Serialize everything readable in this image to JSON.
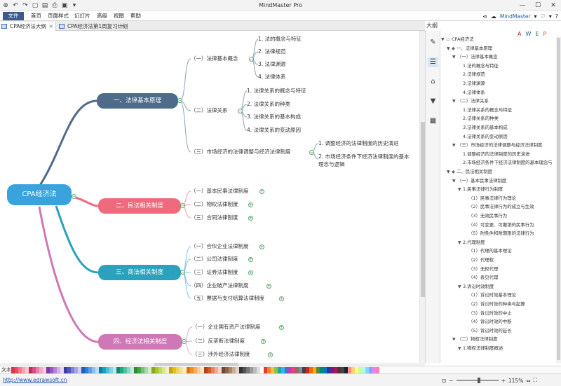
{
  "app": {
    "title": "MindMaster Pro",
    "account": "MindMaster",
    "window_controls": [
      "—",
      "☐",
      "✕"
    ]
  },
  "menubar": {
    "file": "文件",
    "items": [
      "首页",
      "页面样式",
      "幻灯片",
      "高级",
      "视图",
      "帮助"
    ]
  },
  "tabs": [
    {
      "label": "CPA经济法大纲",
      "active": true
    },
    {
      "label": "CPA经济法第1周复习计划",
      "active": false
    }
  ],
  "mindmap": {
    "central": "CPA经济法",
    "branches": [
      {
        "label": "一、法律基本原理",
        "color": "#4e6b89",
        "children": [
          {
            "label": "（一）法律基本概念",
            "children": [
              "1. 法的概念与特征",
              "2. 法律规范",
              "3. 法律渊源",
              "4. 法律体系"
            ]
          },
          {
            "label": "（二）法律关系",
            "children": [
              "1. 法律关系的概念与特征",
              "2. 法律关系的种类",
              "3. 法律关系的基本构成",
              "4. 法律关系的变动原因"
            ]
          },
          {
            "label": "（三）市场经济的法律调整与经济法律制度",
            "children": [
              "1. 调整经济的法律制度的历史演进",
              "2. 市场经济条件下经济法律制度的基本理念与逻辑"
            ]
          }
        ]
      },
      {
        "label": "二、民法相关制度",
        "color": "#ee6a7c",
        "children": [
          {
            "label": "（一）基本民事法律制度"
          },
          {
            "label": "（二）物权法律制度"
          },
          {
            "label": "（三）合同法律制度"
          }
        ]
      },
      {
        "label": "三、商法相关制度",
        "color": "#2aa2be",
        "children": [
          {
            "label": "（一）合伙企业法律制度"
          },
          {
            "label": "（二）公司法律制度"
          },
          {
            "label": "（三）证券法律制度"
          },
          {
            "label": "（四）企业破产法律制度"
          },
          {
            "label": "（五）票据与支付结算法律制度"
          }
        ]
      },
      {
        "label": "四、经济法相关制度",
        "color": "#cf77b7",
        "children": [
          {
            "label": "（一）企业国有资产法律制度"
          },
          {
            "label": "（二）反垄断法律制度"
          },
          {
            "label": "（三）涉外经济法律制度"
          }
        ]
      }
    ]
  },
  "outline": {
    "title": "大纲",
    "tools": [
      "A",
      "W",
      "E",
      "P"
    ],
    "rows": [
      {
        "level": 0,
        "text": "CPA经济法",
        "caret": "▼"
      },
      {
        "level": 1,
        "text": "一、法律基本原理",
        "caret": "▼"
      },
      {
        "level": 2,
        "text": "（一）法律基本概念",
        "caret": "▼"
      },
      {
        "level": 3,
        "text": "1.法的概念与特征"
      },
      {
        "level": 3,
        "text": "2.法律规范"
      },
      {
        "level": 3,
        "text": "3.法律渊源"
      },
      {
        "level": 3,
        "text": "4.法律体系"
      },
      {
        "level": 2,
        "text": "（二）法律关系",
        "caret": "▼"
      },
      {
        "level": 3,
        "text": "1.法律关系的概念与特征"
      },
      {
        "level": 3,
        "text": "2.法律关系的种类"
      },
      {
        "level": 3,
        "text": "3.法律关系的基本构成"
      },
      {
        "level": 3,
        "text": "4.法律关系的变动原因"
      },
      {
        "level": 2,
        "text": "（三）市场经济的法律调整与经济法律制度",
        "caret": "▼"
      },
      {
        "level": 3,
        "text": "1.调整经济的法律制度的历史演进"
      },
      {
        "level": 3,
        "text": "2.市场经济条件下经济法律制度的基本理念与"
      },
      {
        "level": 1,
        "text": "二、民法相关制度",
        "caret": "▼"
      },
      {
        "level": 2,
        "text": "（一）基本民事法律制度",
        "caret": "▼"
      },
      {
        "level": 3,
        "text": "1.民事法律行为制度",
        "caret": "▼"
      },
      {
        "level": 4,
        "text": "（1）民事法律行为理论"
      },
      {
        "level": 4,
        "text": "（2）民事法律行为的成立与生效"
      },
      {
        "level": 4,
        "text": "（3）无效民事行为"
      },
      {
        "level": 4,
        "text": "（4）可变更、可撤销的民事行为"
      },
      {
        "level": 4,
        "text": "（5）附条件和附期限的法律行为"
      },
      {
        "level": 3,
        "text": "2.代理制度",
        "caret": "▼"
      },
      {
        "level": 4,
        "text": "（1）代理的基本理论"
      },
      {
        "level": 4,
        "text": "（2）代理权"
      },
      {
        "level": 4,
        "text": "（3）无权代理"
      },
      {
        "level": 4,
        "text": "（4）表见代理"
      },
      {
        "level": 3,
        "text": "3.诉讼时效制度",
        "caret": "▼"
      },
      {
        "level": 4,
        "text": "（1）诉讼时效基本理论"
      },
      {
        "level": 4,
        "text": "（2）诉讼时效的种类与起算"
      },
      {
        "level": 4,
        "text": "（3）诉讼时效的中止"
      },
      {
        "level": 4,
        "text": "（4）诉讼时效的中断"
      },
      {
        "level": 4,
        "text": "（5）诉讼时效的延长"
      },
      {
        "level": 2,
        "text": "（二）物权法律制度",
        "caret": "▼"
      },
      {
        "level": 3,
        "text": "1.物权法律制度概述",
        "caret": "▼"
      }
    ]
  },
  "palette": {
    "label": "文本",
    "colors": [
      "#d9334a",
      "#e84a6a",
      "#f07a8e",
      "#f4a3b0",
      "#f8c8cf",
      "#b8325e",
      "#d64e86",
      "#e97fab",
      "#f2a8c7",
      "#f8cfe0",
      "#7b3aa8",
      "#9955c4",
      "#b782d6",
      "#d2ade6",
      "#e9d5f2",
      "#3b3f9e",
      "#5457c0",
      "#7d80d3",
      "#a6a8e3",
      "#cfd0f1",
      "#1e5fb0",
      "#2f7fd6",
      "#5fa0e2",
      "#8fbeec",
      "#c0dbf5",
      "#0e7f9a",
      "#17a3c4",
      "#4cbdd6",
      "#86d3e4",
      "#bde8f1",
      "#0f8a6a",
      "#1bab84",
      "#52c3a2",
      "#8ad7c0",
      "#c1ebde",
      "#2e8a2e",
      "#44a844",
      "#75c075",
      "#a6d8a6",
      "#d4ecd4",
      "#8aa51e",
      "#a7c52a",
      "#c2d85c",
      "#d9e78f",
      "#ecf3c5",
      "#c9a21a",
      "#e6bf23",
      "#efd35e",
      "#f5e298",
      "#faf0cc",
      "#d7751a",
      "#ef8f22",
      "#f4ae5d",
      "#f8cc98",
      "#fce6cc",
      "#b0451c",
      "#d55a24",
      "#e28560",
      "#ecae98",
      "#f6d7cc",
      "#6b4a2e",
      "#8a6342",
      "#a98769",
      "#c8ac94",
      "#e4d5c8",
      "#333333",
      "#555555",
      "#777777",
      "#999999",
      "#bbbbbb",
      "#dddddd",
      "#ffffff",
      "#e43d30",
      "#f1842c",
      "#f4c431",
      "#8bc34a",
      "#26a69a",
      "#29b6f6",
      "#5c6bc0",
      "#ab47bc",
      "#ec407a",
      "#8d6e63",
      "#78909c",
      "#424242",
      "#c62828",
      "#ef6c00",
      "#f9a825",
      "#558b2f",
      "#00897b",
      "#0277bd",
      "#283593",
      "#6a1b9a",
      "#ad1457",
      "#4e342e",
      "#37474f",
      "#212121",
      "#ff8a80",
      "#ffd180",
      "#ffff8d",
      "#ccff90",
      "#a7ffeb",
      "#80d8ff",
      "#8c9eff",
      "#ea80fc",
      "#ff80ab"
    ]
  },
  "status": {
    "link": "http://www.edrawsoft.cn",
    "zoom_out": "−",
    "zoom_in": "+",
    "zoom": "115%",
    "zoom_level": 0.55
  }
}
